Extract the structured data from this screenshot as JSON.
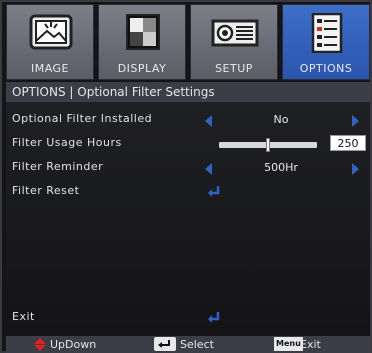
{
  "tabs": [
    {
      "label": "IMAGE",
      "icon": "image-icon",
      "selected": false
    },
    {
      "label": "DISPLAY",
      "icon": "display-icon",
      "selected": false
    },
    {
      "label": "SETUP",
      "icon": "setup-icon",
      "selected": false
    },
    {
      "label": "OPTIONS",
      "icon": "options-icon",
      "selected": true
    }
  ],
  "header": {
    "title": "OPTIONS | Optional Filter Settings"
  },
  "rows": {
    "filter_installed": {
      "label": "Optional Filter Installed",
      "value": "No"
    },
    "filter_usage": {
      "label": "Filter Usage Hours",
      "value": "250"
    },
    "filter_reminder": {
      "label": "Filter Reminder",
      "value": "500Hr"
    },
    "filter_reset": {
      "label": "Filter Reset"
    },
    "exit": {
      "label": "Exit"
    }
  },
  "footer": {
    "updown": "UpDown",
    "select": "Select",
    "menu_key": "Menu",
    "exit": "Exit"
  },
  "colors": {
    "accent": "#2e63c6",
    "selected_tab": "#3d6ec8",
    "footer_arrow": "#e02020"
  }
}
